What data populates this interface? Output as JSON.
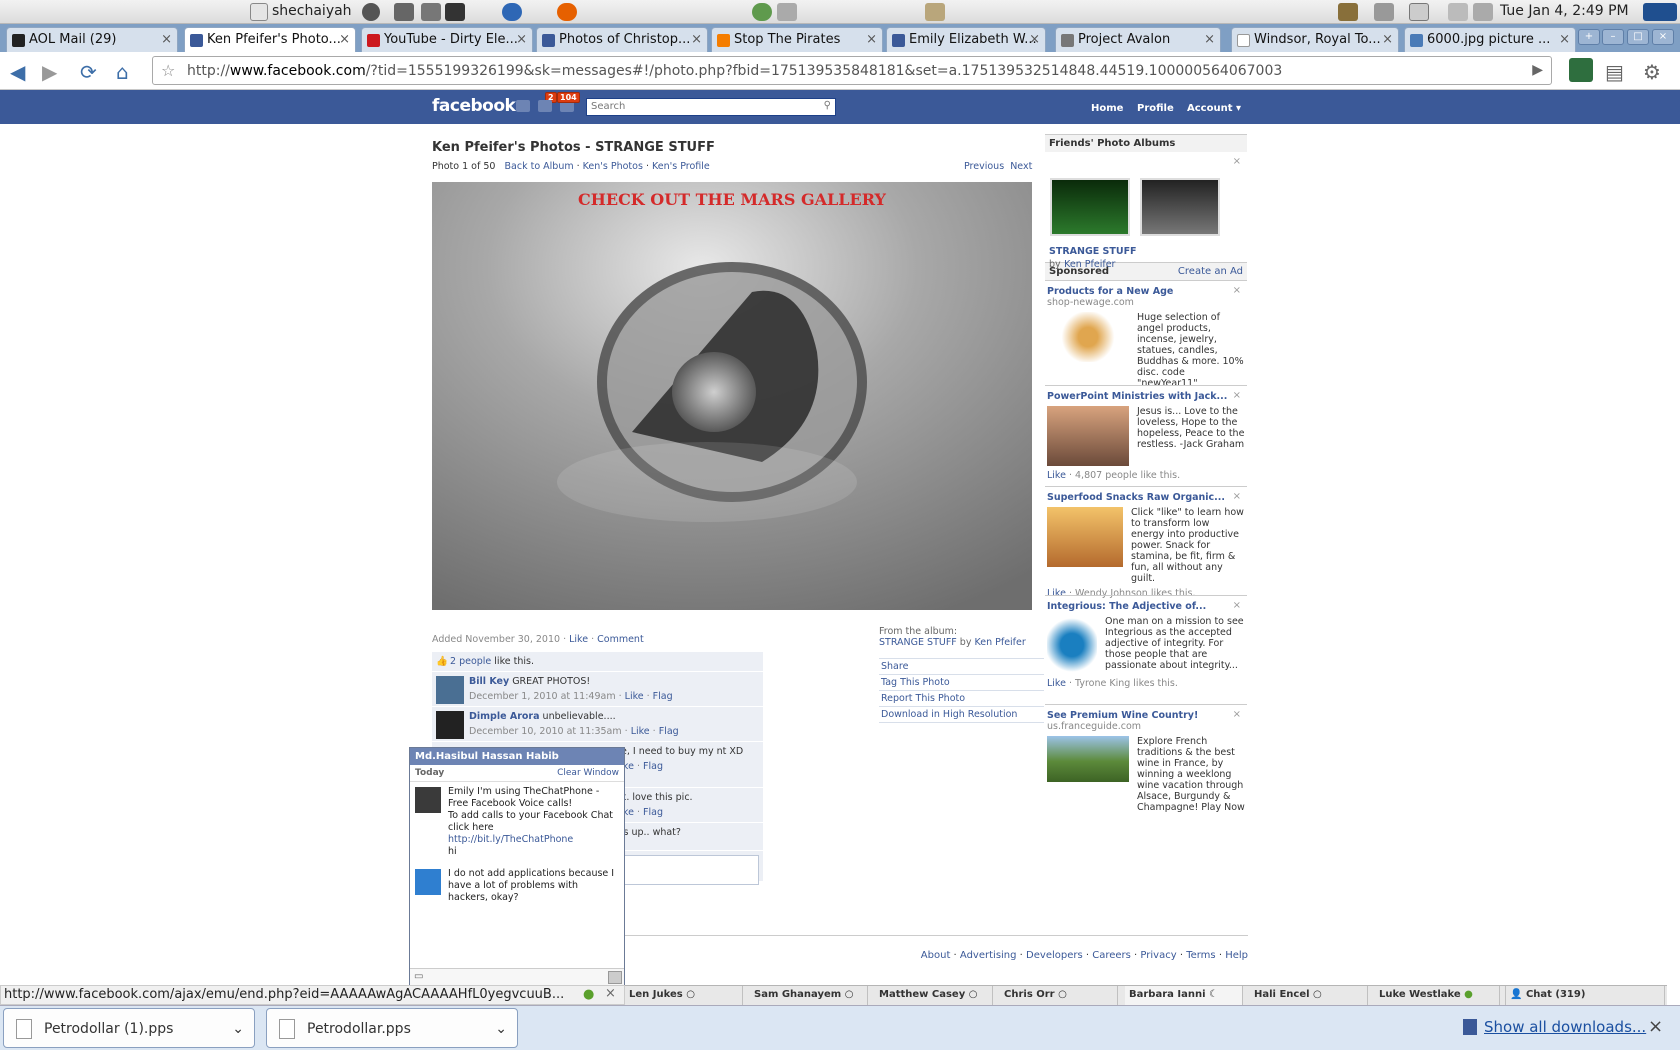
{
  "system": {
    "user": "shechaiyah",
    "clock": "Tue Jan  4,  2:49 PM"
  },
  "tabs": [
    {
      "title": "AOL Mail (29)",
      "favicon": "aol-icon"
    },
    {
      "title": "Ken Pfeifer's Photo...",
      "favicon": "facebook-icon",
      "active": true
    },
    {
      "title": "YouTube - Dirty Ele...",
      "favicon": "youtube-icon"
    },
    {
      "title": "Photos of Christop...",
      "favicon": "facebook-icon"
    },
    {
      "title": "Stop The Pirates",
      "favicon": "blogger-icon"
    },
    {
      "title": "Emily Elizabeth W...",
      "favicon": "facebook-icon"
    },
    {
      "title": "Project Avalon",
      "favicon": "avalon-icon"
    },
    {
      "title": "Windsor, Royal To...",
      "favicon": "page-icon"
    },
    {
      "title": "6000.jpg picture ...",
      "favicon": "image-icon"
    }
  ],
  "address": {
    "prefix": "http://",
    "domain": "www.facebook.com",
    "path": "/?tid=1555199326199&sk=messages#!/photo.php?fbid=175139535848181&set=a.175139532514848.44519.100000564067003"
  },
  "fb": {
    "logo": "facebook",
    "badge_requests": "2",
    "badge_notifications": "104",
    "search_placeholder": "Search",
    "nav": [
      "Home",
      "Profile",
      "Account ▾"
    ]
  },
  "page": {
    "title": "Ken Pfeifer's Photos - STRANGE STUFF",
    "photo_counter": "Photo 1 of 50",
    "back_to_album": "Back to Album",
    "kens_photos": "Ken's Photos",
    "kens_profile": "Ken's Profile",
    "previous": "Previous",
    "next": "Next",
    "photo_caption": "CHECK OUT THE MARS GALLERY",
    "added": "Added November 30, 2010",
    "like": "Like",
    "comment": "Comment",
    "from_album_label": "From the album:",
    "album_name": "STRANGE STUFF",
    "by": "by",
    "album_owner": "Ken Pfeifer",
    "actions": [
      "Share",
      "Tag This Photo",
      "Report This Photo",
      "Download in High Resolution"
    ]
  },
  "likes": {
    "people": "2 people",
    "suffix": "like this."
  },
  "comments": [
    {
      "name": "Bill Key",
      "text": "GREAT PHOTOS!",
      "time": "December 1, 2010 at 11:49am",
      "like": "Like",
      "flag": "Flag"
    },
    {
      "name": "Dimple Arora",
      "text": "unbelievable....",
      "time": "December 10, 2010 at 11:35am",
      "like": "Like",
      "flag": "Flag"
    },
    {
      "name": "",
      "text": "ne, I need to buy my nt XD",
      "time": "",
      "like": "Like",
      "flag": "Flag"
    },
    {
      "name": "",
      "text": "ok. love this pic.",
      "time": "",
      "like": "Like",
      "flag": "Flag"
    },
    {
      "name": "",
      "text": "les up.. what?",
      "time": "",
      "like": "",
      "flag": ""
    }
  ],
  "sidebar": {
    "friends_albums_head": "Friends' Photo Albums",
    "album_title": "STRANGE STUFF",
    "album_by": "by",
    "album_owner": "Ken Pfeifer",
    "sponsored": "Sponsored",
    "create_ad": "Create an Ad",
    "ads": [
      {
        "title": "Products for a New Age",
        "domain": "shop-newage.com",
        "desc": "Huge selection of angel products, incense, jewelry, statues, candles, Buddhas & more. 10% disc. code \"newYear11\"",
        "like": ""
      },
      {
        "title": "PowerPoint Ministries with Jack...",
        "domain": "",
        "desc": "Jesus is... Love to the loveless, Hope to the hopeless, Peace to the restless. -Jack Graham",
        "like": "4,807 people like this."
      },
      {
        "title": "Superfood Snacks Raw Organic...",
        "domain": "",
        "desc": "Click \"like\" to learn how to transform low energy into productive power. Snack for stamina, be fit, firm & fun, all without any guilt.",
        "like": "Wendy Johnson likes this."
      },
      {
        "title": "Integrious: The Adjective of...",
        "domain": "",
        "desc": "One man on a mission to see Integrious as the accepted adjective of integrity. For those people that are passionate about integrity...",
        "like": "Tyrone King likes this."
      },
      {
        "title": "See Premium Wine Country!",
        "domain": "us.franceguide.com",
        "desc": "Explore French traditions & the best wine in France, by winning a weeklong wine vacation through Alsace, Burgundy & Champagne! Play Now",
        "like": ""
      }
    ],
    "like_label": "Like"
  },
  "footer": [
    "About",
    "Advertising",
    "Developers",
    "Careers",
    "Privacy",
    "Terms",
    "Help"
  ],
  "chat": {
    "name": "Md.Hasibul Hassan Habib",
    "today": "Today",
    "clear": "Clear Window",
    "messages": [
      {
        "text": "Emily I'm using TheChatPhone - Free Facebook Voice calls!\nTo add calls to your Facebook Chat click here",
        "link": "http://bit.ly/TheChatPhone",
        "tail": "hi"
      },
      {
        "text": "I do not add applications because I have a lot of problems with hackers, okay?",
        "link": "",
        "tail": ""
      }
    ]
  },
  "chatbar": {
    "buddies": [
      "Len Jukes",
      "Sam Ghanayem",
      "Matthew Casey",
      "Chris Orr",
      "Barbara Ianni",
      "Hali Encel",
      "Luke Westlake"
    ],
    "chat_label": "Chat (319)"
  },
  "statusbar": "http://www.facebook.com/ajax/emu/end.php?eid=AAAAAwAgACAAAAHfL0yegvcuuB...",
  "downloads": {
    "items": [
      "Petrodollar (1).pps",
      "Petrodollar.pps"
    ],
    "show_all": "Show all downloads..."
  }
}
